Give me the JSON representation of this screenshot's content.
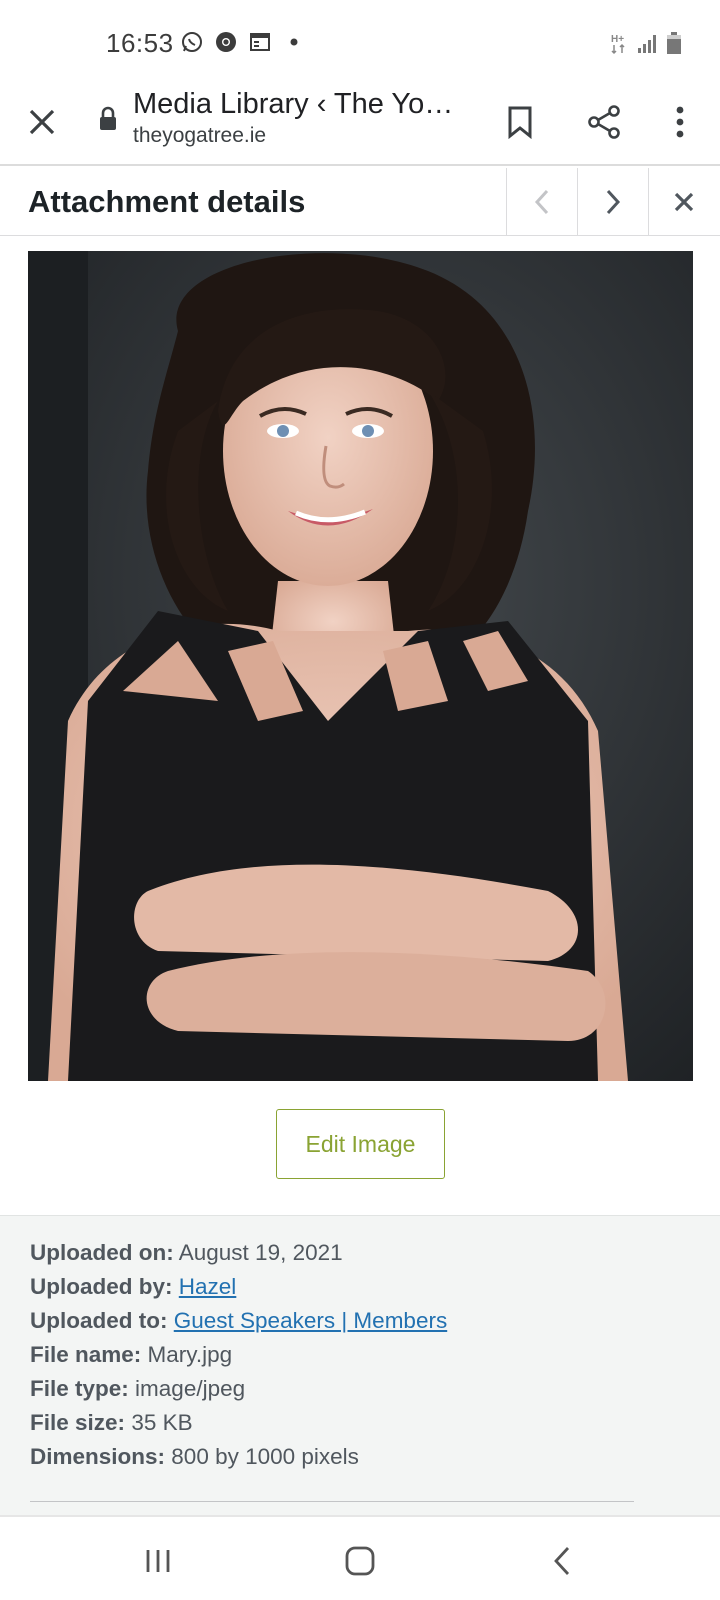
{
  "status_bar": {
    "time": "16:53",
    "left_icons": [
      "whatsapp-icon",
      "chrome-icon",
      "calendar-icon",
      "dot-icon"
    ],
    "right_icons": [
      "network-hplus-icon",
      "signal-icon",
      "battery-icon"
    ]
  },
  "browser": {
    "title": "Media Library ‹ The Yo…",
    "url": "theyogatree.ie"
  },
  "attachment": {
    "header_title": "Attachment details",
    "edit_button_label": "Edit Image"
  },
  "details": {
    "uploaded_on_label": "Uploaded on:",
    "uploaded_on_value": "August 19, 2021",
    "uploaded_by_label": "Uploaded by:",
    "uploaded_by_value": "Hazel",
    "uploaded_to_label": "Uploaded to:",
    "uploaded_to_value": "Guest Speakers | Members",
    "file_name_label": "File name:",
    "file_name_value": "Mary.jpg",
    "file_type_label": "File type:",
    "file_type_value": "image/jpeg",
    "file_size_label": "File size:",
    "file_size_value": "35 KB",
    "dimensions_label": "Dimensions:",
    "dimensions_value": "800 by 1000 pixels"
  },
  "colors": {
    "accent_green": "#8aa333",
    "link_blue": "#2271b1",
    "panel_bg": "#f3f5f4"
  }
}
